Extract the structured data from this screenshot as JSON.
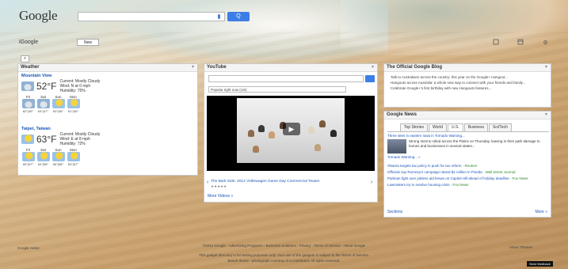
{
  "header": {
    "logo": "Google",
    "search_button": "Q",
    "igoogle": "iGoogle",
    "new_button": "New",
    "add_button": "+",
    "icons": [
      "window-icon",
      "calendar-icon",
      "gear-icon"
    ],
    "gear_glyph": "⚙"
  },
  "weather": {
    "title": "Weather",
    "menu": "▾",
    "cities": [
      {
        "name": "Mountain View",
        "temp": "52°F",
        "desc": [
          "Current: Mostly Cloudy",
          "Wind: N at 0 mph",
          "Humidity: 75%"
        ],
        "forecast": [
          {
            "day": "Fri",
            "hl": "62°|45°"
          },
          {
            "day": "Sat",
            "hl": "64°|47°"
          },
          {
            "day": "Sun",
            "hl": "63°|46°"
          },
          {
            "day": "Mon",
            "hl": "61°|45°"
          }
        ]
      },
      {
        "name": "Taipei, Taiwan",
        "temp": "63°F",
        "desc": [
          "Current: Mostly Cloudy",
          "Wind: E at 8 mph",
          "Humidity: 72%"
        ],
        "forecast": [
          {
            "day": "Fri",
            "hl": "65°|57°"
          },
          {
            "day": "Sat",
            "hl": "64°|58°"
          },
          {
            "day": "Sun",
            "hl": "66°|58°"
          },
          {
            "day": "Mon",
            "hl": "63°|57°"
          }
        ]
      }
    ]
  },
  "youtube": {
    "title": "YouTube",
    "menu": "▾",
    "select_value": "Popular right now (US)",
    "video_title": "The Bark Side: 2012 Volkswagen Game Day Commercial Teaser",
    "stars": "★★★★★",
    "play": "▶",
    "prev": "‹",
    "next": "›",
    "more": "More Videos »"
  },
  "blog": {
    "title": "The Official Google Blog",
    "menu": "▾",
    "items": [
      "Talk to Australians across the country: this year on the Google+ Hangout...",
      "Hangouts across Australia: a whole new way to connect with your friends and family...",
      "Celebrate Google+'s first birthday with new Hangouts features..."
    ]
  },
  "news": {
    "title": "Google News",
    "menu": "▾",
    "tabs": [
      "Top Stories",
      "World",
      "U.S.",
      "Business",
      "Sci/Tech"
    ],
    "selected_tab": 2,
    "headline": "Three sites in eastern Iowa in Tornado Warning...",
    "snippet": "Strong storms rolled across the Plains on Thursday, leaving in their path damage to homes and businesses in several states...",
    "headline_more": "Tornado Warning... »",
    "stories": [
      {
        "title": "Obama targets tax policy in push for tax reform",
        "source": "- Reuters"
      },
      {
        "title": "Officials say Romney's campaign raised $1 million in Florida",
        "source": "- Wall Street Journal"
      },
      {
        "title": "Partisan fight over jobless aid brews on Capitol Hill ahead of holiday deadline",
        "source": "- Fox News"
      },
      {
        "title": "Lawmakers try to resolve housing crisis",
        "source": "- Fox News"
      }
    ],
    "sections": "Sections",
    "more": "More »"
  },
  "footer": {
    "left": "Google Home",
    "right": "About Themes",
    "line1": "©2012 Google - Advertising Programs - Business Solutions - Privacy - Terms of Service - About Google",
    "line2": "This gadget directory is for testing purposes only. Your use of the gadgets is subject to the Terms of Service.",
    "line3": "Beach theme - photograph courtesy of a contributor. All rights reserved.",
    "credit": "Send feedback"
  }
}
